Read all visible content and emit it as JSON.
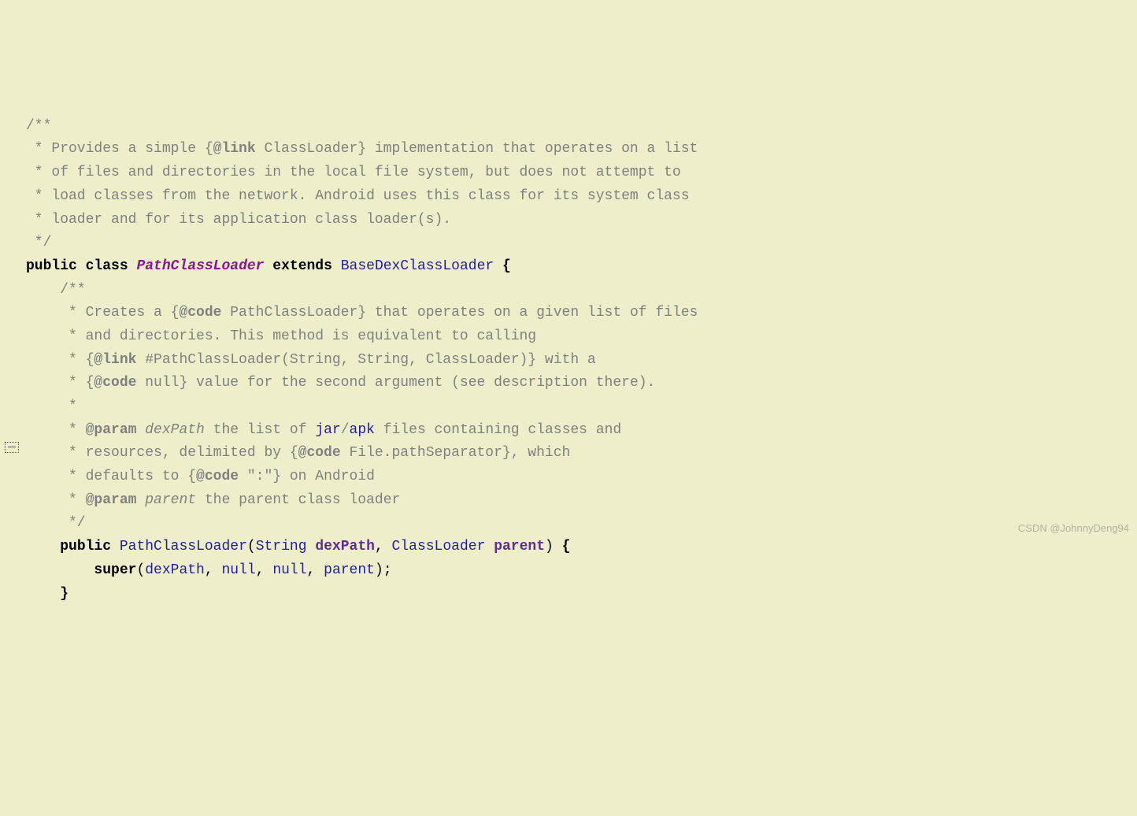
{
  "c1": "/**",
  "c2": " * Provides a simple {",
  "tag_link1": "@link",
  "c2b": " ClassLoader} implementation that operates on a list",
  "c3": " * of files and directories in the local file system, but does not attempt to",
  "c4": " * load classes from the network. Android uses this class for its system class",
  "c5": " * loader and for its application class loader(s).",
  "c6": " */",
  "kw_public": "public",
  "kw_class": "class",
  "cls_name": "PathClassLoader",
  "kw_extends": "extends",
  "base_cls": "BaseDexClassLoader",
  "brace_open": "{",
  "d1": "    /**",
  "d2a": "     * Creates a {",
  "tag_code1": "@code",
  "d2b": " PathClassLoader} that operates on a given list of files",
  "d3": "     * and directories. This method is equivalent to calling",
  "d4a": "     * {",
  "tag_link2": "@link",
  "d4b": " #PathClassLoader(String, String, ClassLoader)} with a",
  "d5a": "     * {",
  "tag_code2": "@code",
  "d5b": " null} value for the second argument (see description there).",
  "d6": "     *",
  "d7a": "     * ",
  "tag_param1": "@param",
  "d7_param": "dexPath",
  "d7b": " the list of ",
  "jar": "jar",
  "slash": "/",
  "apk": "apk",
  "d7c": " files containing classes and",
  "d8a": "     * resources, delimited by {",
  "tag_code3": "@code",
  "d8b": " File.pathSeparator}, which",
  "d9a": "     * defaults to {",
  "tag_code4": "@code",
  "d9_str": " \":\"",
  "d9b": "} on Android",
  "d10a": "     * ",
  "tag_param2": "@param",
  "d10_param": "parent",
  "d10b": " the parent class loader",
  "d11": "     */",
  "kw_public2": "public",
  "method_name": "PathClassLoader",
  "paren_open": "(",
  "type_string": "String",
  "arg1": "dexPath",
  "comma": ", ",
  "type_classloader": "ClassLoader",
  "arg2": "parent",
  "paren_close": ")",
  "brace_open2": " {",
  "kw_super": "super",
  "super_open": "(",
  "super_arg1": "dexPath",
  "kw_null1": "null",
  "kw_null2": "null",
  "super_arg4": "parent",
  "super_close": ");",
  "brace_close": "    }",
  "watermark": "CSDN @JohnnyDeng94"
}
